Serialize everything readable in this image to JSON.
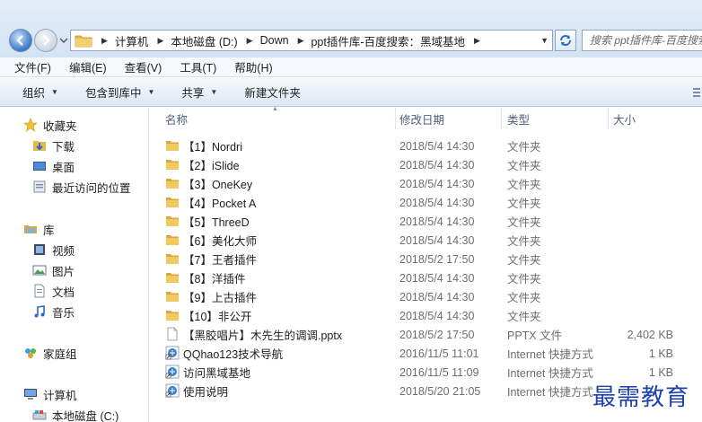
{
  "address_bar": {
    "crumbs": [
      "计算机",
      "本地磁盘 (D:)",
      "Down",
      "ppt插件库-百度搜索：黑域基地"
    ],
    "search_placeholder": "搜索 ppt插件库-百度搜索..."
  },
  "menu": [
    "文件(F)",
    "编辑(E)",
    "查看(V)",
    "工具(T)",
    "帮助(H)"
  ],
  "commands": {
    "organize": "组织",
    "include_library": "包含到库中",
    "share": "共享",
    "new_folder": "新建文件夹"
  },
  "nav": {
    "favorites": "收藏夹",
    "downloads": "下载",
    "desktop": "桌面",
    "recent": "最近访问的位置",
    "libraries": "库",
    "videos": "视频",
    "pictures": "图片",
    "documents": "文档",
    "music": "音乐",
    "homegroup": "家庭组",
    "computer": "计算机",
    "local_disk_c": "本地磁盘 (C:)"
  },
  "columns": {
    "name": "名称",
    "date": "修改日期",
    "type": "类型",
    "size": "大小"
  },
  "files": [
    {
      "name": "【1】Nordri",
      "date": "2018/5/4 14:30",
      "type": "文件夹",
      "size": "",
      "icon": "folder-icon"
    },
    {
      "name": "【2】iSlide",
      "date": "2018/5/4 14:30",
      "type": "文件夹",
      "size": "",
      "icon": "folder-icon"
    },
    {
      "name": "【3】OneKey",
      "date": "2018/5/4 14:30",
      "type": "文件夹",
      "size": "",
      "icon": "folder-icon"
    },
    {
      "name": "【4】Pocket A",
      "date": "2018/5/4 14:30",
      "type": "文件夹",
      "size": "",
      "icon": "folder-icon"
    },
    {
      "name": "【5】ThreeD",
      "date": "2018/5/4 14:30",
      "type": "文件夹",
      "size": "",
      "icon": "folder-icon"
    },
    {
      "name": "【6】美化大师",
      "date": "2018/5/4 14:30",
      "type": "文件夹",
      "size": "",
      "icon": "folder-icon"
    },
    {
      "name": "【7】王者插件",
      "date": "2018/5/2 17:50",
      "type": "文件夹",
      "size": "",
      "icon": "folder-icon"
    },
    {
      "name": "【8】洋插件",
      "date": "2018/5/4 14:30",
      "type": "文件夹",
      "size": "",
      "icon": "folder-icon"
    },
    {
      "name": "【9】上古插件",
      "date": "2018/5/4 14:30",
      "type": "文件夹",
      "size": "",
      "icon": "folder-icon"
    },
    {
      "name": "【10】非公开",
      "date": "2018/5/4 14:30",
      "type": "文件夹",
      "size": "",
      "icon": "folder-icon"
    },
    {
      "name": "【黑胶唱片】木先生的调调.pptx",
      "date": "2018/5/2 17:50",
      "type": "PPTX 文件",
      "size": "2,402 KB",
      "icon": "document-icon"
    },
    {
      "name": "QQhao123技术导航",
      "date": "2016/11/5 11:01",
      "type": "Internet 快捷方式",
      "size": "1 KB",
      "icon": "web-shortcut-icon"
    },
    {
      "name": "访问黑域基地",
      "date": "2016/11/5 11:09",
      "type": "Internet 快捷方式",
      "size": "1 KB",
      "icon": "web-shortcut-icon"
    },
    {
      "name": "使用说明",
      "date": "2018/5/20 21:05",
      "type": "Internet 快捷方式",
      "size": "",
      "icon": "web-shortcut-icon"
    }
  ],
  "watermark": "最需教育",
  "colors": {
    "folder": "#e8b84a",
    "header_text": "#4c607a",
    "watermark": "#1f3fae"
  }
}
